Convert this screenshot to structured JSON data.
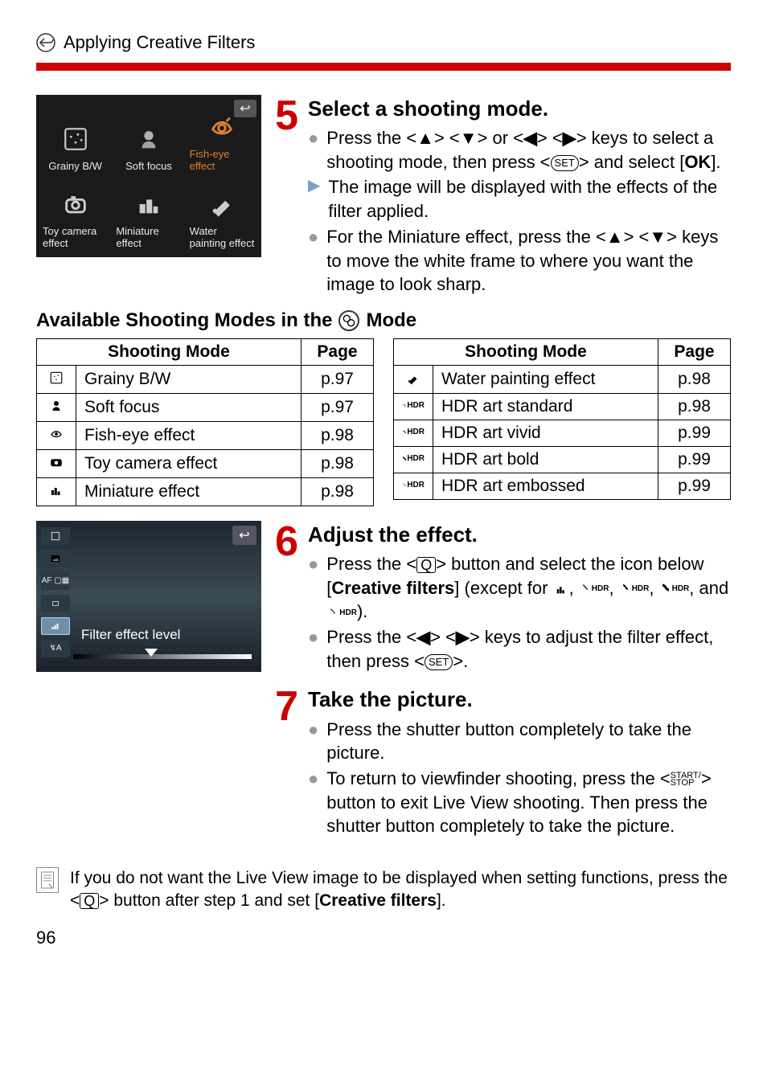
{
  "header": {
    "title": "Applying Creative Filters"
  },
  "filter_grid": {
    "items": [
      {
        "label": "Grainy B/W"
      },
      {
        "label": "Soft focus"
      },
      {
        "label": "Fish-eye effect"
      },
      {
        "label": "Toy camera effect"
      },
      {
        "label": "Miniature effect"
      },
      {
        "label": "Water painting effect"
      }
    ],
    "selected_index": 2
  },
  "step5": {
    "number": "5",
    "title": "Select a shooting mode.",
    "b1_a": "Press the <",
    "b1_b": "> <",
    "b1_c": "> or <",
    "b1_d": "> <",
    "b1_e": "> keys to select a shooting mode, then press <",
    "b1_f": "> and select [",
    "b1_g": "OK",
    "b1_h": "].",
    "b2": "The image will be displayed with the effects of the filter applied.",
    "b3_a": "For the Miniature effect, press the <",
    "b3_b": "> <",
    "b3_c": "> keys to move the white frame to where you want the image to look sharp."
  },
  "subhead": {
    "before": "Available Shooting Modes in the ",
    "after": " Mode"
  },
  "tables": {
    "header_mode": "Shooting Mode",
    "header_page": "Page",
    "left": [
      {
        "name": "Grainy B/W",
        "page": "p.97"
      },
      {
        "name": "Soft focus",
        "page": "p.97"
      },
      {
        "name": "Fish-eye effect",
        "page": "p.98"
      },
      {
        "name": "Toy camera effect",
        "page": "p.98"
      },
      {
        "name": "Miniature effect",
        "page": "p.98"
      }
    ],
    "right": [
      {
        "name": "Water painting effect",
        "page": "p.98"
      },
      {
        "name": "HDR art standard",
        "page": "p.98"
      },
      {
        "name": "HDR art vivid",
        "page": "p.99"
      },
      {
        "name": "HDR art bold",
        "page": "p.99"
      },
      {
        "name": "HDR art embossed",
        "page": "p.99"
      }
    ]
  },
  "effect_preview": {
    "label": "Filter effect level"
  },
  "step6": {
    "number": "6",
    "title": "Adjust the effect.",
    "b1_a": "Press the <",
    "b1_b": "> button and select the icon below [",
    "b1_c": "Creative filters",
    "b1_d": "] (except for ",
    "b1_e": ", ",
    "b1_f": ", and ",
    "b1_g": ").",
    "b2_a": "Press the <",
    "b2_b": "> <",
    "b2_c": "> keys to adjust the filter effect, then press <",
    "b2_d": ">."
  },
  "step7": {
    "number": "7",
    "title": "Take the picture.",
    "b1": "Press the shutter button completely to take the picture.",
    "b2_a": "To return to viewfinder shooting, press the <",
    "b2_start_stop_top": "START/",
    "b2_start_stop_bottom": "STOP",
    "b2_b": "> button to exit Live View shooting. Then press the shutter button completely to take the picture."
  },
  "footnote": {
    "a": "If you do not want the Live View image to be displayed when setting functions, press the <",
    "b": "> button after step 1 and set [",
    "c": "Creative filters",
    "d": "]."
  },
  "page_number": "96",
  "glyphs": {
    "up": "▲",
    "down": "▼",
    "left": "◀",
    "right": "▶",
    "set": "SET",
    "q": "Q",
    "return": "↩"
  }
}
